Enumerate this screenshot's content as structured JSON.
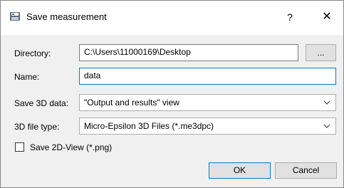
{
  "window": {
    "title": "Save measurement",
    "help_label": "?",
    "close_label": "✕"
  },
  "directory": {
    "label": "Directory:",
    "value": "C:\\Users\\11000169\\Desktop",
    "browse_label": "..."
  },
  "name": {
    "label": "Name:",
    "value": "data"
  },
  "save3d": {
    "label": "Save 3D data:",
    "selected": "\"Output and results\" view"
  },
  "filetype": {
    "label": "3D file type:",
    "selected": "Micro-Epsilon 3D Files (*.me3dpc)"
  },
  "save2d": {
    "label": "Save 2D-View (*.png)",
    "checked": false
  },
  "buttons": {
    "ok": "OK",
    "cancel": "Cancel"
  },
  "colors": {
    "accent": "#0078d7",
    "dialog_bg": "#f0f0f0",
    "titlebar_bg": "#ffffff"
  }
}
